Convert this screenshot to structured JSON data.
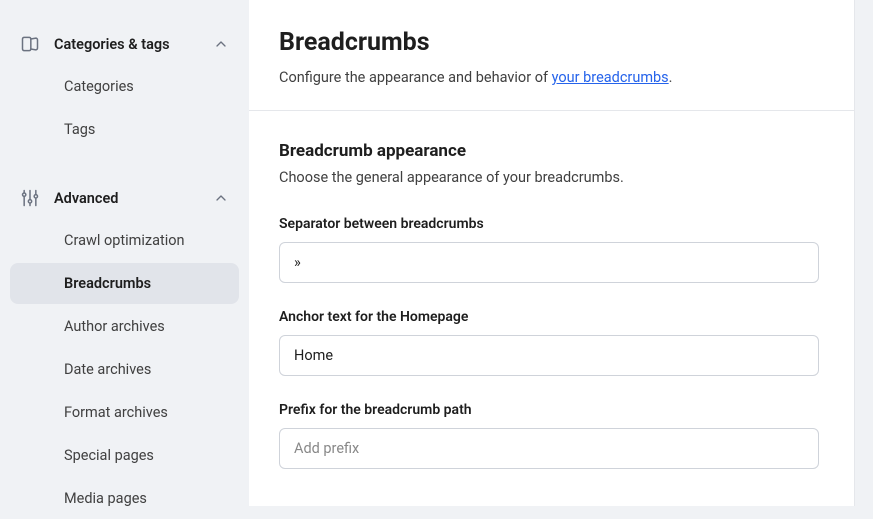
{
  "sidebar": {
    "groups": [
      {
        "label": "Categories & tags",
        "items": [
          {
            "label": "Categories"
          },
          {
            "label": "Tags"
          }
        ]
      },
      {
        "label": "Advanced",
        "items": [
          {
            "label": "Crawl optimization"
          },
          {
            "label": "Breadcrumbs"
          },
          {
            "label": "Author archives"
          },
          {
            "label": "Date archives"
          },
          {
            "label": "Format archives"
          },
          {
            "label": "Special pages"
          },
          {
            "label": "Media pages"
          }
        ]
      }
    ]
  },
  "page": {
    "title": "Breadcrumbs",
    "subtitle_prefix": "Configure the appearance and behavior of ",
    "subtitle_link": "your breadcrumbs",
    "subtitle_suffix": "."
  },
  "section": {
    "title": "Breadcrumb appearance",
    "desc": "Choose the general appearance of your breadcrumbs."
  },
  "fields": {
    "separator": {
      "label": "Separator between breadcrumbs",
      "value": "»"
    },
    "anchor": {
      "label": "Anchor text for the Homepage",
      "value": "Home"
    },
    "prefix": {
      "label": "Prefix for the breadcrumb path",
      "placeholder": "Add prefix"
    }
  }
}
